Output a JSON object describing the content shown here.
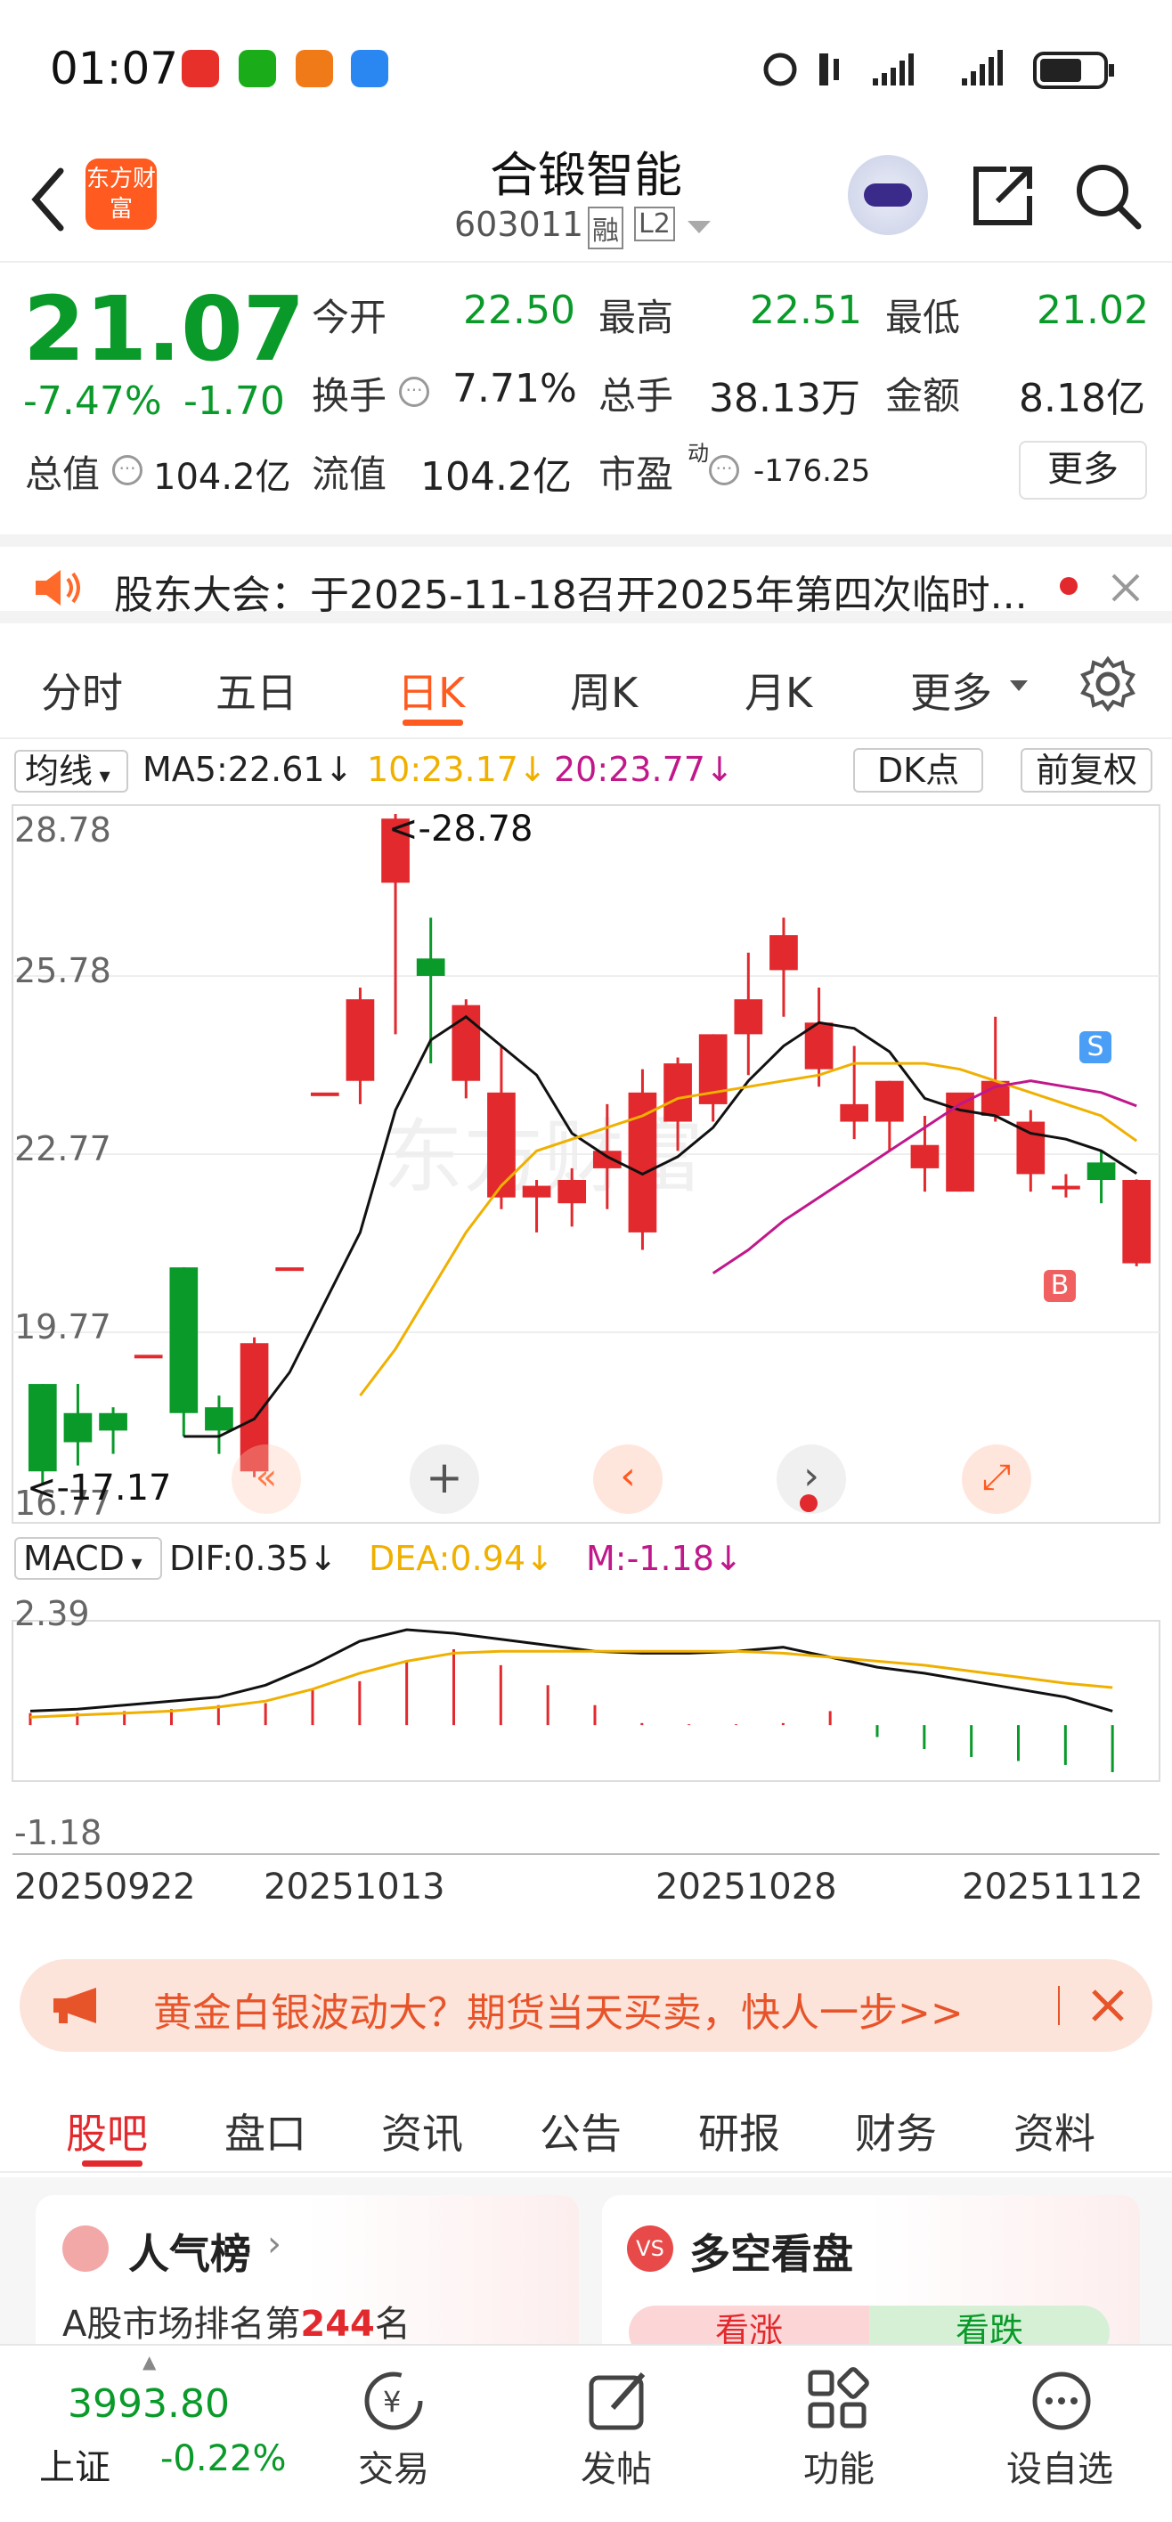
{
  "status_bar": {
    "time": "01:07"
  },
  "header": {
    "stock_name": "合锻智能",
    "stock_code": "603011",
    "badge_margin": "融",
    "badge_l2": "L2",
    "logo_text": "东方财富"
  },
  "quote": {
    "price": "21.07",
    "change_pct": "-7.47%",
    "change": "-1.70",
    "open_label": "今开",
    "open": "22.50",
    "high_label": "最高",
    "high": "22.51",
    "low_label": "最低",
    "low": "21.02",
    "turnover_label": "换手",
    "turnover": "7.71%",
    "volume_label": "总手",
    "volume": "38.13万",
    "amount_label": "金额",
    "amount": "8.18亿",
    "mktcap_label": "总值",
    "mktcap": "104.2亿",
    "float_label": "流值",
    "float": "104.2亿",
    "pe_label": "市盈",
    "pe_sup": "动",
    "pe": "-176.25",
    "more_label": "更多"
  },
  "notice": {
    "text": "股东大会：于2025-11-18召开2025年第四次临时..."
  },
  "chart_tabs": [
    "分时",
    "五日",
    "日K",
    "周K",
    "月K",
    "更多"
  ],
  "active_chart_tab": "日K",
  "kline": {
    "indicator_label": "均线",
    "ma5": "MA5:22.61↓",
    "ma10": "10:23.17↓",
    "ma20": "20:23.77↓",
    "dk_label": "DK点",
    "adjust_label": "前复权",
    "price_ticks": [
      "28.78",
      "25.78",
      "22.77",
      "19.77",
      "16.77"
    ],
    "max_label": "<-28.78",
    "min_label": "<-17.17",
    "s_marker": "S",
    "b_marker": "B",
    "watermark": "东方财富"
  },
  "macd": {
    "indicator_label": "MACD",
    "dif": "DIF:0.35↓",
    "dea": "DEA:0.94↓",
    "m": "M:-1.18↓",
    "ticks": [
      "2.39",
      "-1.18"
    ]
  },
  "date_ticks": [
    "20250922",
    "20251013",
    "20251028",
    "20251112"
  ],
  "colors": {
    "up": "#e2292d",
    "down": "#0a9a2a",
    "ma5": "#111111",
    "ma10": "#f0b000",
    "ma20": "#c0188a",
    "accent": "#ff5a1f"
  },
  "chart_data": {
    "type": "candlestick",
    "x": [
      "20250922",
      "",
      "",
      "",
      "",
      "",
      "",
      "",
      "",
      "",
      "20251013",
      "",
      "",
      "",
      "",
      "",
      "",
      "",
      "",
      "",
      "",
      "20251028",
      "",
      "",
      "",
      "",
      "",
      "",
      "",
      "",
      "",
      "",
      "20251112"
    ],
    "ohlc": [
      [
        19.0,
        19.0,
        17.3,
        17.5
      ],
      [
        18.5,
        19.0,
        17.6,
        18.0
      ],
      [
        18.5,
        18.6,
        17.8,
        18.2
      ],
      [
        19.5,
        19.5,
        19.5,
        19.5
      ],
      [
        21.0,
        21.0,
        18.1,
        18.5
      ],
      [
        18.6,
        18.8,
        17.8,
        18.2
      ],
      [
        17.5,
        19.8,
        17.4,
        19.7
      ],
      [
        21.0,
        21.0,
        21.0,
        21.0
      ],
      [
        24.0,
        24.0,
        24.0,
        24.0
      ],
      [
        24.2,
        25.8,
        23.8,
        25.6
      ],
      [
        27.6,
        28.78,
        25.0,
        28.7
      ],
      [
        26.3,
        27.0,
        24.5,
        26.0
      ],
      [
        24.2,
        25.6,
        23.9,
        25.5
      ],
      [
        22.2,
        24.8,
        22.0,
        24.0
      ],
      [
        22.2,
        22.5,
        21.6,
        22.4
      ],
      [
        22.1,
        22.7,
        21.7,
        22.5
      ],
      [
        22.7,
        23.8,
        22.0,
        23.0
      ],
      [
        21.6,
        24.4,
        21.3,
        24.0
      ],
      [
        23.5,
        24.6,
        23.0,
        24.5
      ],
      [
        23.8,
        25.0,
        23.5,
        25.0
      ],
      [
        25.0,
        26.4,
        24.3,
        25.6
      ],
      [
        26.1,
        27.0,
        25.3,
        26.7
      ],
      [
        24.4,
        25.8,
        24.1,
        25.2
      ],
      [
        23.5,
        24.8,
        23.2,
        23.8
      ],
      [
        23.5,
        24.2,
        23.0,
        24.2
      ],
      [
        22.7,
        23.6,
        22.3,
        23.1
      ],
      [
        22.3,
        23.9,
        22.3,
        24.0
      ],
      [
        23.6,
        25.3,
        23.5,
        24.2
      ],
      [
        22.6,
        23.7,
        22.3,
        23.5
      ],
      [
        22.4,
        22.6,
        22.2,
        22.4
      ],
      [
        22.8,
        23.0,
        22.1,
        22.5
      ],
      [
        21.07,
        22.51,
        21.02,
        22.5
      ]
    ],
    "series": [
      {
        "name": "MA5",
        "values": [
          null,
          null,
          null,
          null,
          18.1,
          18.1,
          18.4,
          19.2,
          20.4,
          21.6,
          23.7,
          24.9,
          25.3,
          24.8,
          24.3,
          23.3,
          22.9,
          22.6,
          22.9,
          23.4,
          24.2,
          24.8,
          25.2,
          25.1,
          24.7,
          23.9,
          23.7,
          23.6,
          23.3,
          23.2,
          23.0,
          22.61
        ]
      },
      {
        "name": "10",
        "values": [
          null,
          null,
          null,
          null,
          null,
          null,
          null,
          null,
          null,
          18.8,
          19.6,
          20.6,
          21.6,
          22.4,
          23.0,
          23.2,
          23.4,
          23.6,
          23.9,
          24.0,
          24.1,
          24.2,
          24.3,
          24.5,
          24.5,
          24.5,
          24.4,
          24.2,
          24.0,
          23.8,
          23.6,
          23.17
        ]
      },
      {
        "name": "20",
        "values": [
          null,
          null,
          null,
          null,
          null,
          null,
          null,
          null,
          null,
          null,
          null,
          null,
          null,
          null,
          null,
          null,
          null,
          null,
          null,
          20.9,
          21.3,
          21.8,
          22.2,
          22.6,
          23.0,
          23.4,
          23.8,
          24.1,
          24.2,
          24.1,
          24.0,
          23.77
        ]
      }
    ],
    "macd": {
      "dif": [
        0.35,
        0.4,
        0.5,
        0.6,
        0.7,
        1.0,
        1.5,
        2.1,
        2.39,
        2.3,
        2.15,
        2.0,
        1.85,
        1.8,
        1.8,
        1.85,
        1.95,
        1.7,
        1.45,
        1.3,
        1.1,
        0.9,
        0.7,
        0.35
      ],
      "dea": [
        0.2,
        0.25,
        0.3,
        0.35,
        0.45,
        0.6,
        0.9,
        1.3,
        1.6,
        1.8,
        1.85,
        1.85,
        1.85,
        1.85,
        1.85,
        1.85,
        1.8,
        1.7,
        1.6,
        1.5,
        1.35,
        1.2,
        1.05,
        0.94
      ],
      "m": [
        0.3,
        0.3,
        0.35,
        0.4,
        0.5,
        0.55,
        0.9,
        1.1,
        1.6,
        1.9,
        1.5,
        1.0,
        0.5,
        0.05,
        0.02,
        0.02,
        0.05,
        0.35,
        -0.3,
        -0.6,
        -0.8,
        -0.9,
        -1.0,
        -1.18
      ]
    },
    "ylim": [
      16.77,
      28.78
    ]
  },
  "ad": {
    "text": "黄金白银波动大？期货当天买卖，快人一步>>"
  },
  "sub_tabs": [
    "股吧",
    "盘口",
    "资讯",
    "公告",
    "研报",
    "财务",
    "资料"
  ],
  "active_sub_tab": "股吧",
  "cards": {
    "popularity_title": "人气榜",
    "popularity_text": "A股市场排名第",
    "popularity_rank": "244",
    "popularity_suffix": "名",
    "sentiment_title": "多空看盘",
    "bull_label": "看涨",
    "bear_label": "看跌"
  },
  "bottom_bar": {
    "index_value": "3993.80",
    "index_name": "上证",
    "index_change": "-0.22%",
    "nav": [
      "交易",
      "发帖",
      "功能",
      "设自选"
    ]
  }
}
